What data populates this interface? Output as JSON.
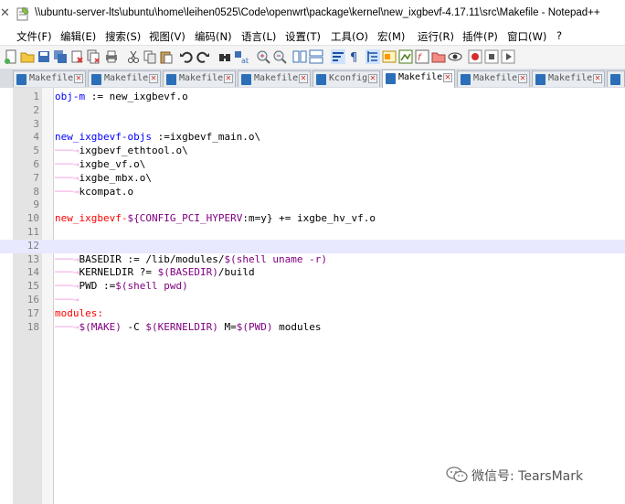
{
  "window": {
    "title": "\\\\ubuntu-server-lts\\ubuntu\\home\\leihen0525\\Code\\openwrt\\package\\kernel\\new_ixgbevf-4.17.11\\src\\Makefile - Notepad++"
  },
  "menu": {
    "items": [
      "文件(F)",
      "编辑(E)",
      "搜索(S)",
      "视图(V)",
      "编码(N)",
      "语言(L)",
      "设置(T)",
      "工具(O)",
      "宏(M)",
      "运行(R)",
      "插件(P)",
      "窗口(W)",
      "?"
    ]
  },
  "tabs": [
    "Makefile",
    "Makefile",
    "Makefile",
    "Makefile",
    "Kconfig",
    "Makefile",
    "Makefile",
    "Makefile"
  ],
  "editor": {
    "line_numbers": [
      "1",
      "2",
      "3",
      "4",
      "5",
      "6",
      "7",
      "8",
      "9",
      "10",
      "11",
      "12",
      "13",
      "14",
      "15",
      "16",
      "17",
      "18"
    ],
    "current_line": 12,
    "lines": {
      "l1": [
        "obj-m",
        " := new_ixgbevf.o"
      ],
      "l4": [
        "new_ixgbevf-objs",
        " :=ixgbevf_main.o\\"
      ],
      "l5": "ixgbevf_ethtool.o\\",
      "l6": "ixgbe_vf.o\\",
      "l7": "ixgbe_mbx.o\\",
      "l8": "kcompat.o",
      "l10": [
        "new_ixgbevf-",
        "${CONFIG_PCI_HYPERV",
        ":m=y}",
        " += ixgbe_hv_vf.o"
      ],
      "l13": [
        "BASEDIR := /lib/modules/",
        "$(shell uname -r)"
      ],
      "l14": [
        "KERNELDIR ?= ",
        "$(BASEDIR)",
        "/build"
      ],
      "l15": [
        "PWD :=",
        "$(shell pwd)"
      ],
      "l17": "modules:",
      "l18": [
        "$(MAKE)",
        " -C ",
        "$(KERNELDIR)",
        " M=",
        "$(PWD)",
        " modules"
      ]
    }
  },
  "watermark": {
    "text": "微信号: TearsMark"
  },
  "colors": {
    "keyword_blue": "#0000ff",
    "variable_purple": "#800080",
    "target_red": "#ff0000",
    "tab_arrow": "#f0a2e0",
    "current_line": "#e8e8ff"
  }
}
